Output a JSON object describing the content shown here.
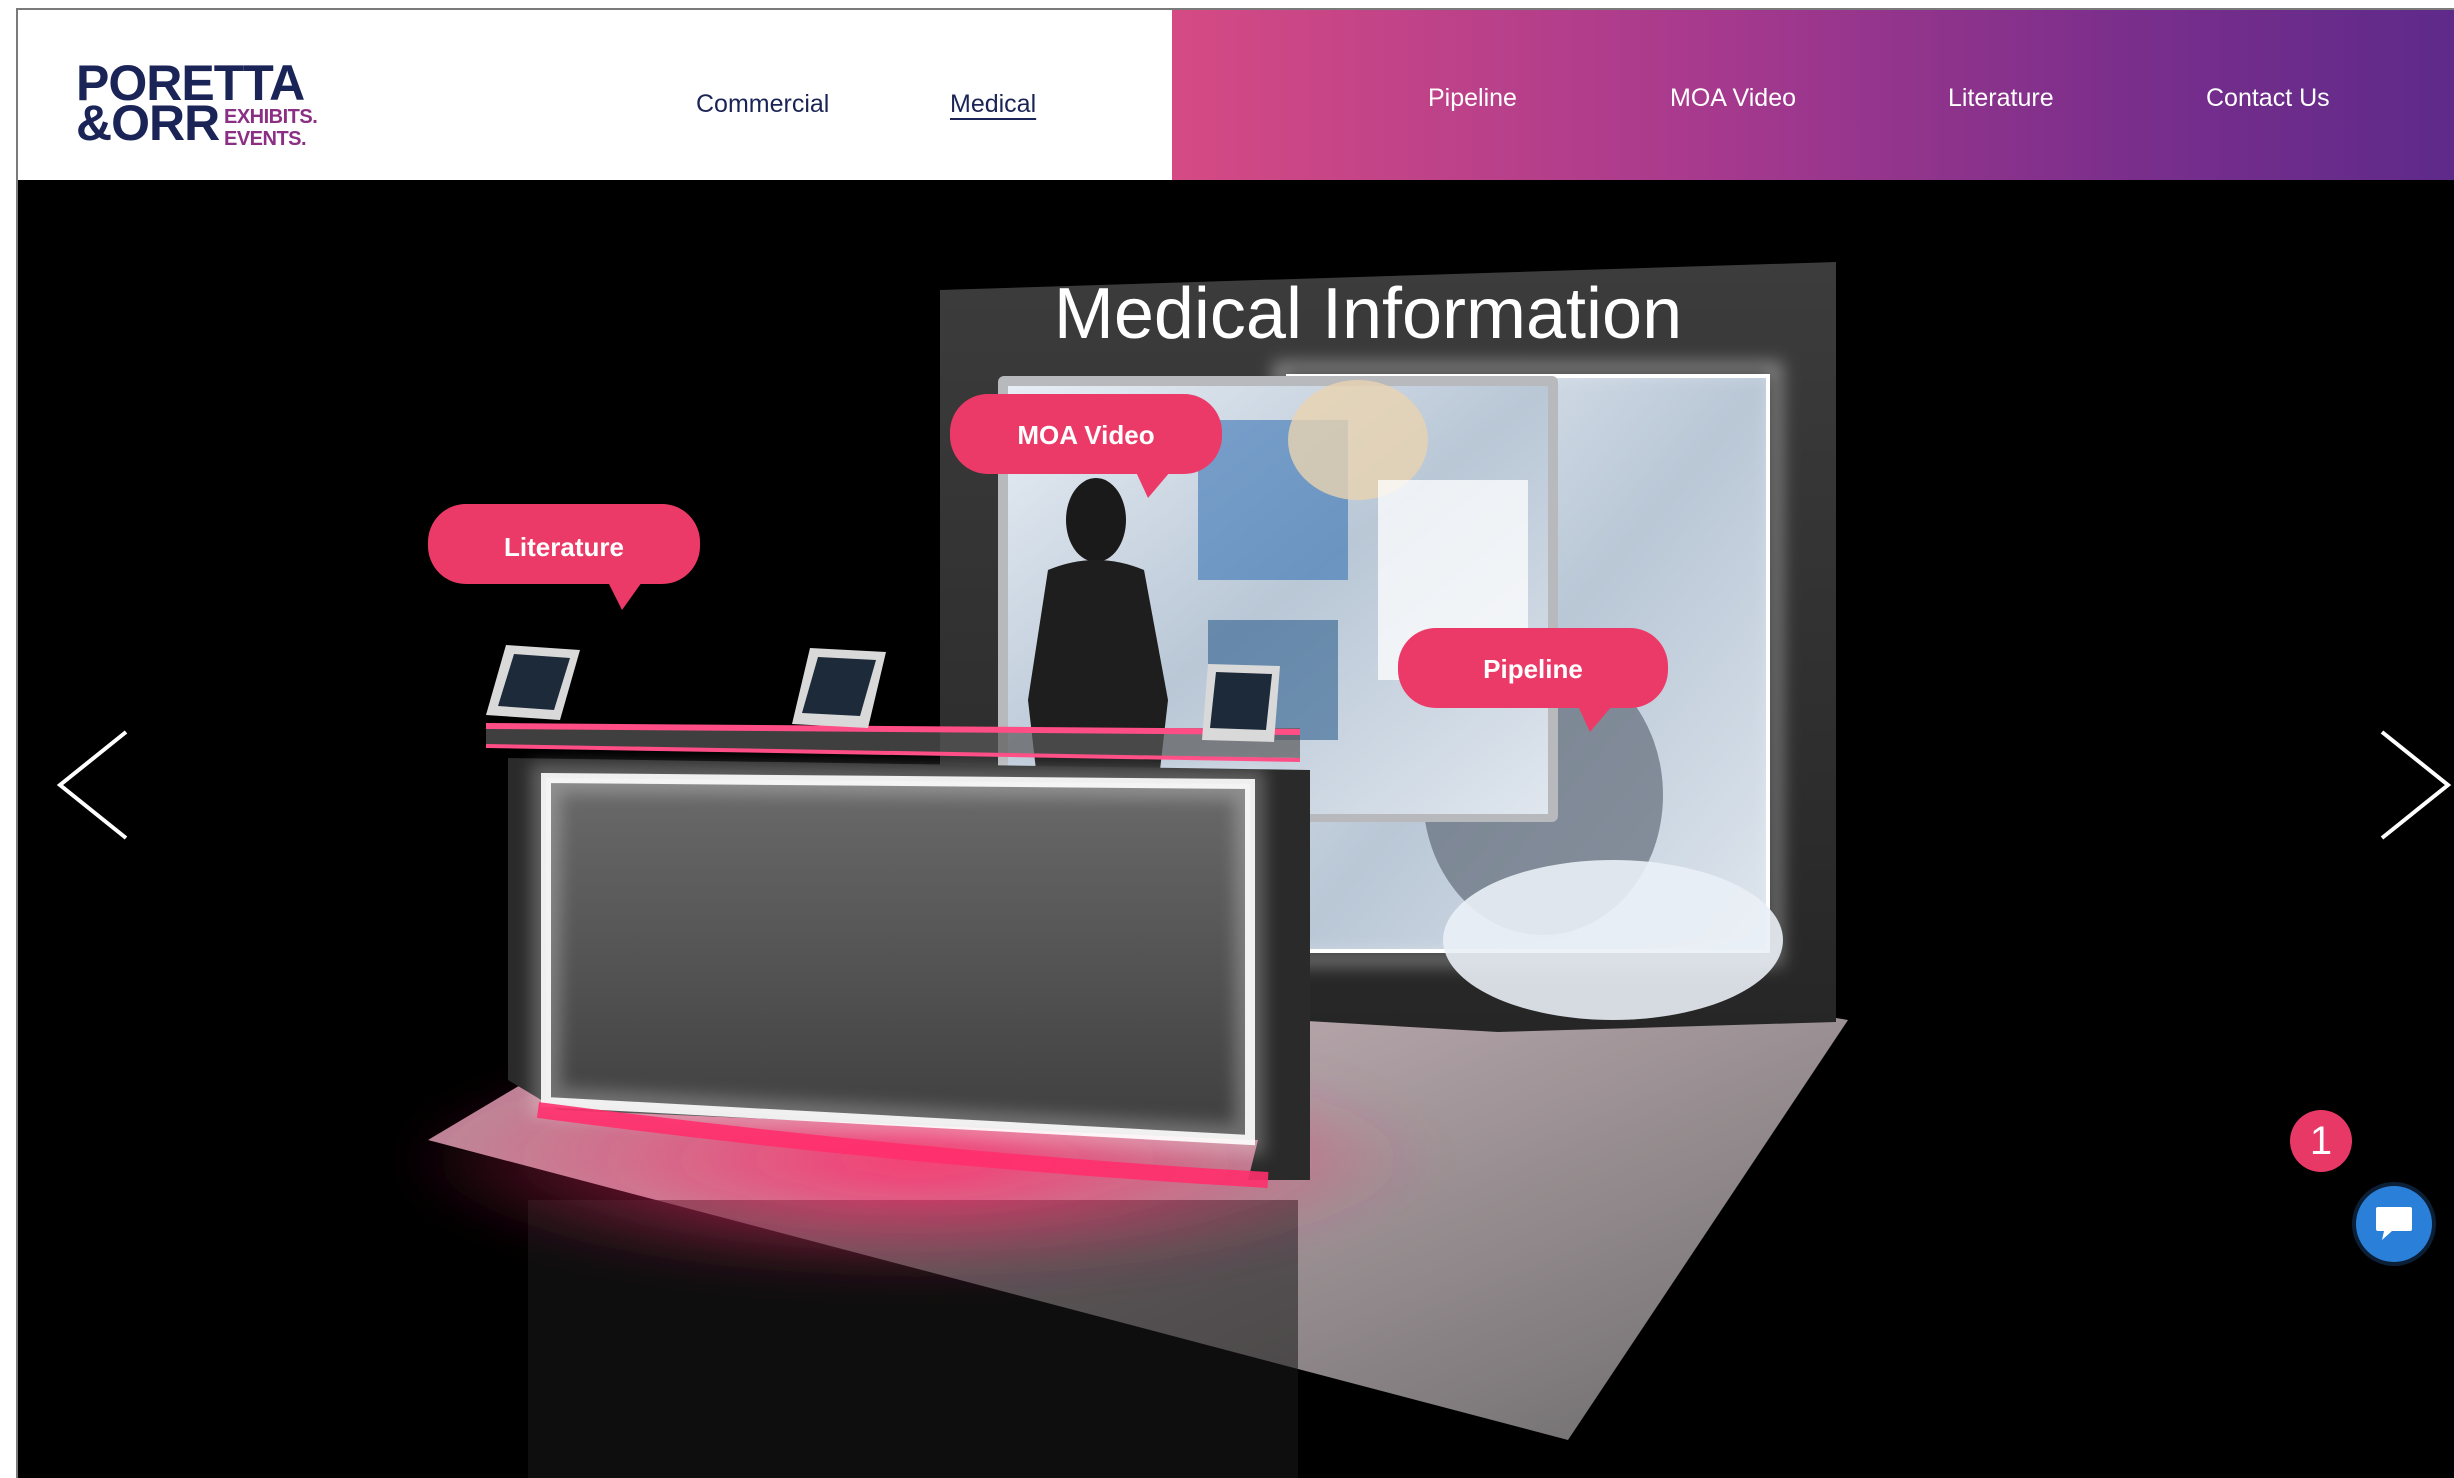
{
  "logo": {
    "line1": "PORETTA",
    "line2": "&ORR",
    "tag1": "EXHIBITS.",
    "tag2": "EVENTS."
  },
  "nav_left": [
    {
      "label": "Commercial"
    },
    {
      "label": "Medical"
    }
  ],
  "nav_right": [
    {
      "label": "Pipeline"
    },
    {
      "label": "MOA Video"
    },
    {
      "label": "Literature"
    },
    {
      "label": "Contact Us"
    }
  ],
  "booth": {
    "screen_title": "Medical Information",
    "hotspots": [
      {
        "label": "MOA Video"
      },
      {
        "label": "Literature"
      },
      {
        "label": "Pipeline"
      }
    ]
  },
  "chat": {
    "notification_count": "1"
  },
  "colors": {
    "accent": "#e83866",
    "nav_gradient_start": "#d54a84",
    "nav_gradient_end": "#5e2a8a",
    "brand_navy": "#1b2456",
    "chat_blue": "#2a7fd8"
  }
}
